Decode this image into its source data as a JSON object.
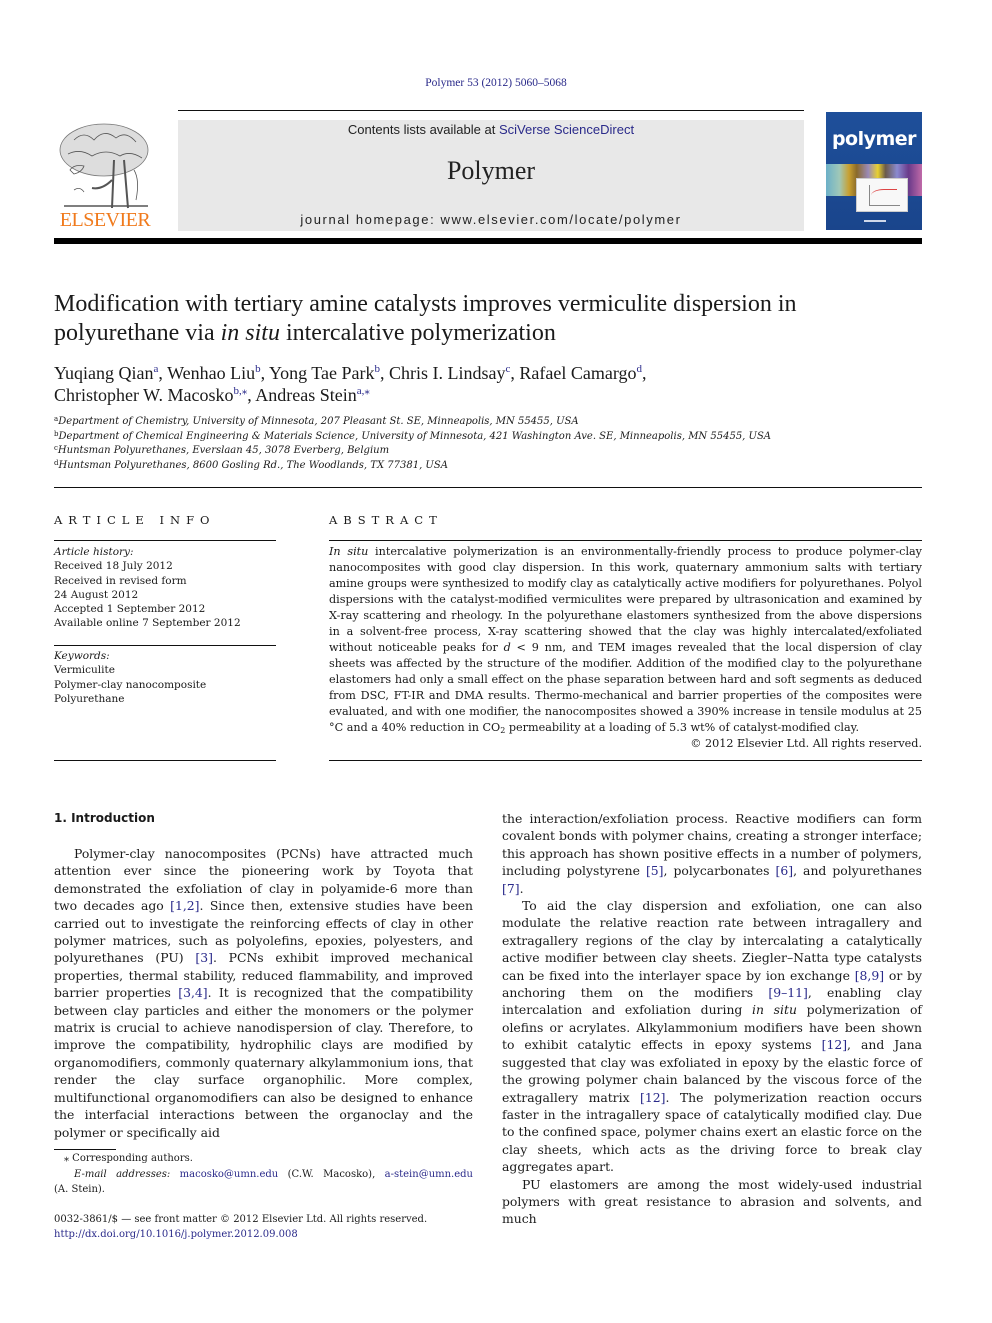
{
  "header": {
    "citation": "Polymer 53 (2012) 5060–5068",
    "contents_prefix": "Contents lists available at ",
    "contents_link": "SciVerse ScienceDirect",
    "journal_name": "Polymer",
    "homepage": "journal homepage: www.elsevier.com/locate/polymer",
    "publisher_logo_text": "ELSEVIER",
    "cover_title": "polymer",
    "colors": {
      "link": "#2a2a8a",
      "elsevier_orange": "#f07a1c",
      "cover_blue": "#1e4f9a",
      "banner_gray": "#e8e8e8"
    }
  },
  "article": {
    "title_part1": "Modification with tertiary amine catalysts improves vermiculite dispersion in polyurethane via ",
    "title_italic": "in situ",
    "title_part2": " intercalative polymerization",
    "authors": [
      {
        "name": "Yuqiang Qian",
        "aff": "a",
        "sep": ", "
      },
      {
        "name": "Wenhao Liu",
        "aff": "b",
        "sep": ", "
      },
      {
        "name": "Yong Tae Park",
        "aff": "b",
        "sep": ", "
      },
      {
        "name": "Chris I. Lindsay",
        "aff": "c",
        "sep": ", "
      },
      {
        "name": "Rafael Camargo",
        "aff": "d",
        "sep": ","
      },
      {
        "name": "Christopher W. Macosko",
        "aff": "b,⁎",
        "sep": ", "
      },
      {
        "name": "Andreas Stein",
        "aff": "a,⁎",
        "sep": ""
      }
    ],
    "affiliations": [
      {
        "key": "a",
        "text": "Department of Chemistry, University of Minnesota, 207 Pleasant St. SE, Minneapolis, MN 55455, USA"
      },
      {
        "key": "b",
        "text": "Department of Chemical Engineering & Materials Science, University of Minnesota, 421 Washington Ave. SE, Minneapolis, MN 55455, USA"
      },
      {
        "key": "c",
        "text": "Huntsman Polyurethanes, Everslaan 45, 3078 Everberg, Belgium"
      },
      {
        "key": "d",
        "text": "Huntsman Polyurethanes, 8600 Gosling Rd., The Woodlands, TX 77381, USA"
      }
    ]
  },
  "article_info": {
    "heading": "ARTICLE INFO",
    "history_label": "Article history:",
    "history": [
      "Received 18 July 2012",
      "Received in revised form",
      "24 August 2012",
      "Accepted 1 September 2012",
      "Available online 7 September 2012"
    ],
    "keywords_label": "Keywords:",
    "keywords": [
      "Vermiculite",
      "Polymer-clay nanocomposite",
      "Polyurethane"
    ]
  },
  "abstract": {
    "heading": "ABSTRACT",
    "lead_italic": "In situ",
    "text_1": " intercalative polymerization is an environmentally-friendly process to produce polymer-clay nanocomposites with good clay dispersion. In this work, quaternary ammonium salts with tertiary amine groups were synthesized to modify clay as catalytically active modifiers for polyurethanes. Polyol dispersions with the catalyst-modified vermiculites were prepared by ultrasonication and examined by X-ray scattering and rheology. In the polyurethane elastomers synthesized from the above dispersions in a solvent-free process, X-ray scattering showed that the clay was highly intercalated/exfoliated without noticeable peaks for ",
    "var_d": "d",
    "text_2": " < 9 nm, and TEM images revealed that the local dispersion of clay sheets was affected by the structure of the modifier. Addition of the modified clay to the polyurethane elastomers had only a small effect on the phase separation between hard and soft segments as deduced from DSC, FT-IR and DMA results. Thermo-mechanical and barrier properties of the composites were evaluated, and with one modifier, the nanocomposites showed a 390% increase in tensile modulus at 25 °C and a 40% reduction in CO",
    "sub_2": "2",
    "text_3": " permeability at a loading of 5.3 wt% of catalyst-modified clay.",
    "copyright": "© 2012 Elsevier Ltd. All rights reserved."
  },
  "introduction": {
    "heading": "1.  Introduction",
    "left_p1": [
      {
        "t": "Polymer-clay nanocomposites (PCNs) have attracted much attention ever since the pioneering work by Toyota that demonstrated the exfoliation of clay in polyamide-6 more than two decades ago "
      },
      {
        "ref": "[1,2]"
      },
      {
        "t": ". Since then, extensive studies have been carried out to investigate the reinforcing effects of clay in other polymer matrices, such as polyolefins, epoxies, polyesters, and polyurethanes (PU) "
      },
      {
        "ref": "[3]"
      },
      {
        "t": ". PCNs exhibit improved mechanical properties, thermal stability, reduced flammability, and improved barrier properties "
      },
      {
        "ref": "[3,4]"
      },
      {
        "t": ". It is recognized that the compatibility between clay particles and either the monomers or the polymer matrix is crucial to achieve nanodispersion of clay. Therefore, to improve the compatibility, hydrophilic clays are modified by organomodifiers, commonly quaternary alkylammonium ions, that render the clay surface organophilic. More complex, multifunctional organomodifiers can also be designed to enhance the interfacial interactions between the organoclay and the polymer or specifically aid"
      }
    ],
    "right_p1": [
      {
        "t": "the interaction/exfoliation process. Reactive modifiers can form covalent bonds with polymer chains, creating a stronger interface; this approach has shown positive effects in a number of polymers, including polystyrene "
      },
      {
        "ref": "[5]"
      },
      {
        "t": ", polycarbonates "
      },
      {
        "ref": "[6]"
      },
      {
        "t": ", and polyurethanes "
      },
      {
        "ref": "[7]"
      },
      {
        "t": "."
      }
    ],
    "right_p2": [
      {
        "t": "To aid the clay dispersion and exfoliation, one can also modulate the relative reaction rate between intragallery and extragallery regions of the clay by intercalating a catalytically active modifier between clay sheets. Ziegler–Natta type catalysts can be fixed into the interlayer space by ion exchange "
      },
      {
        "ref": "[8,9]"
      },
      {
        "t": " or by anchoring them on the modifiers "
      },
      {
        "ref": "[9–11]"
      },
      {
        "t": ", enabling clay intercalation and exfoliation during "
      },
      {
        "em": "in situ"
      },
      {
        "t": " polymerization of olefins or acrylates. Alkylammonium modifiers have been shown to exhibit catalytic effects in epoxy systems "
      },
      {
        "ref": "[12]"
      },
      {
        "t": ", and Jana suggested that clay was exfoliated in epoxy by the elastic force of the growing polymer chain balanced by the viscous force of the extragallery matrix "
      },
      {
        "ref": "[12]"
      },
      {
        "t": ". The polymerization reaction occurs faster in the intragallery space of catalytically modified clay. Due to the confined space, polymer chains exert an elastic force on the clay sheets, which acts as the driving force to break clay aggregates apart."
      }
    ],
    "right_p3": [
      {
        "t": "PU elastomers are among the most widely-used industrial polymers with great resistance to abrasion and solvents, and much"
      }
    ]
  },
  "footnotes": {
    "corresponding": "⁎ Corresponding authors.",
    "email_label": "E-mail addresses:",
    "email_1": "macosko@umn.edu",
    "email_1_who": " (C.W. Macosko), ",
    "email_2": "a-stein@umn.edu",
    "email_2_who": "(A. Stein).",
    "front_matter": "0032-3861/$ — see front matter © 2012 Elsevier Ltd. All rights reserved.",
    "doi": "http://dx.doi.org/10.1016/j.polymer.2012.09.008"
  }
}
